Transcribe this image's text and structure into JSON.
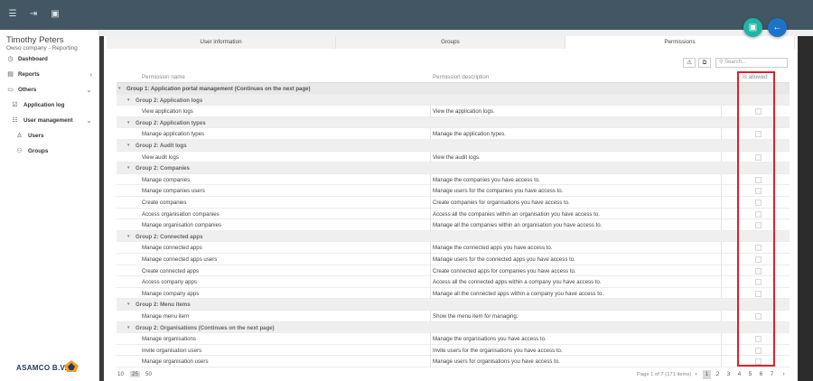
{
  "icons": {
    "menu": "menu-icon",
    "logout": "logout-icon",
    "window": "window-icon"
  },
  "user": {
    "name": "Timothy Peters",
    "company": "Owso company - Reporting"
  },
  "nav": {
    "dashboard": "Dashboard",
    "reports": "Reports",
    "others": "Others",
    "application_log": "Application log",
    "user_management": "User management",
    "users": "Users",
    "groups": "Groups"
  },
  "logo": {
    "text": "ASAMCO B.V."
  },
  "tabs": [
    "User information",
    "Groups",
    "Permissions"
  ],
  "toolbar": {
    "search_placeholder": "Search..."
  },
  "columns": {
    "name": "Permission name",
    "description": "Permission description",
    "allowed": "Is allowed"
  },
  "rows": [
    {
      "type": "group1",
      "text": "Group 1: Application portal management (Continues on the next page)"
    },
    {
      "type": "group",
      "text": "Group 2: Application logs"
    },
    {
      "type": "item",
      "name": "View application logs",
      "desc": "View the application logs."
    },
    {
      "type": "group",
      "text": "Group 2: Application types"
    },
    {
      "type": "item",
      "name": "Manage application types",
      "desc": "Manage the application types."
    },
    {
      "type": "group",
      "text": "Group 2: Audit logs"
    },
    {
      "type": "item",
      "name": "View audit logs",
      "desc": "View the audit logs."
    },
    {
      "type": "group",
      "text": "Group 2: Companies"
    },
    {
      "type": "item",
      "name": "Manage companies",
      "desc": "Manage the companies you have access to."
    },
    {
      "type": "item",
      "name": "Manage companies users",
      "desc": "Manage users for the companies you have access to."
    },
    {
      "type": "item",
      "name": "Create companies",
      "desc": "Create companies for organisations you have access to."
    },
    {
      "type": "item",
      "name": "Access organisation companies",
      "desc": "Access all the companies within an organisation you have access to."
    },
    {
      "type": "item",
      "name": "Manage organisation companies",
      "desc": "Manage all the companies within an organisation you have access to."
    },
    {
      "type": "group",
      "text": "Group 2: Connected apps"
    },
    {
      "type": "item",
      "name": "Manage connected apps",
      "desc": "Manage the connected apps you have access to."
    },
    {
      "type": "item",
      "name": "Manage connected apps users",
      "desc": "Manage users for the connected apps you have access to."
    },
    {
      "type": "item",
      "name": "Create connected apps",
      "desc": "Create connected apps for companies you have access to."
    },
    {
      "type": "item",
      "name": "Access company apps",
      "desc": "Access all the connected apps within a company you have access to."
    },
    {
      "type": "item",
      "name": "Manage company apps",
      "desc": "Manage all the connected apps within a company you have access to."
    },
    {
      "type": "group",
      "text": "Group 2: Menu items"
    },
    {
      "type": "item",
      "name": "Manage menu item",
      "desc": "Show the menu item for managing."
    },
    {
      "type": "group",
      "text": "Group 2: Organisations (Continues on the next page)"
    },
    {
      "type": "item",
      "name": "Manage organisations",
      "desc": "Manage the organisations you have access to."
    },
    {
      "type": "item",
      "name": "Invite organisation users",
      "desc": "Invite users for the organisations you have access to."
    },
    {
      "type": "item",
      "name": "Manage organisation users",
      "desc": "Manage users for organisations you have access to."
    }
  ],
  "footer": {
    "page_sizes": [
      "10",
      "25",
      "50"
    ],
    "selected_size": "25",
    "page_info": "Page 1 of 7 (171 items)",
    "pages": [
      "1",
      "2",
      "3",
      "4",
      "5",
      "6",
      "7"
    ],
    "current_page": "1",
    "prev": "‹",
    "next": "›"
  },
  "colors": {
    "topbar": "#425663",
    "save_fab": "#1fb5a3",
    "back_fab": "#1d74c6",
    "highlight": "#e0202a"
  }
}
